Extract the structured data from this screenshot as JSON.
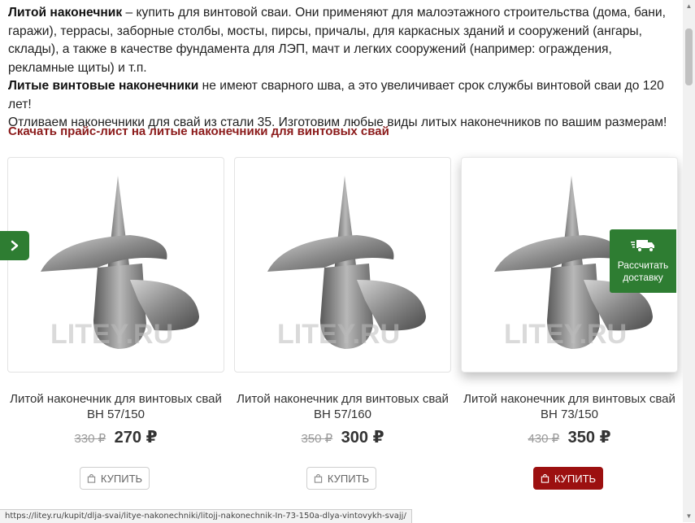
{
  "intro": {
    "p1_bold": "Литой наконечник",
    "p1_text": " – купить для винтовой сваи. Они применяют для малоэтажного строительства (дома, бани, гаражи), террасы, заборные столбы, мосты, пирсы, причалы, для каркасных зданий и сооружений (ангары, склады), а также в качестве фундамента для ЛЭП, мачт и легких сооружений (например: ограждения, рекламные щиты) и т.п.",
    "p2_bold": "Литые винтовые наконечники",
    "p2_text": " не имеют сварного шва, а это увеличивает срок службы винтовой сваи до 120 лет!",
    "p3_text": "Отливаем наконечники для свай из стали 35. Изготовим любые виды литых наконечников по вашим размерам!"
  },
  "price_link": "Скачать прайс-лист на литые наконечники для винтовых свай",
  "products": [
    {
      "title": "Литой наконечник для винтовых свай ВН 57/150",
      "old_price": "330 ₽",
      "price": "270 ₽",
      "buy_label": "КУПИТЬ",
      "watermark": "LITEY.RU"
    },
    {
      "title": "Литой наконечник для винтовых свай ВН 57/160",
      "old_price": "350 ₽",
      "price": "300 ₽",
      "buy_label": "КУПИТЬ",
      "watermark": "LITEY.RU"
    },
    {
      "title": "Литой наконечник для винтовых свай ВН 73/150",
      "old_price": "430 ₽",
      "price": "350 ₽",
      "buy_label": "КУПИТЬ",
      "watermark": "LITEY.RU"
    }
  ],
  "delivery_widget": {
    "label": "Рассчитать доставку",
    "icon": "truck-icon"
  },
  "carousel": {
    "next_icon": "chevron-right-icon"
  },
  "status_bar_url": "https://litey.ru/kupit/dlja-svai/litye-nakonechniki/litojj-nakonechnik-In-73-150a-dlya-vintovykh-svajj/",
  "colors": {
    "accent_green": "#2e7d32",
    "accent_red": "#9c1010",
    "link_red": "#8b1a1a"
  }
}
